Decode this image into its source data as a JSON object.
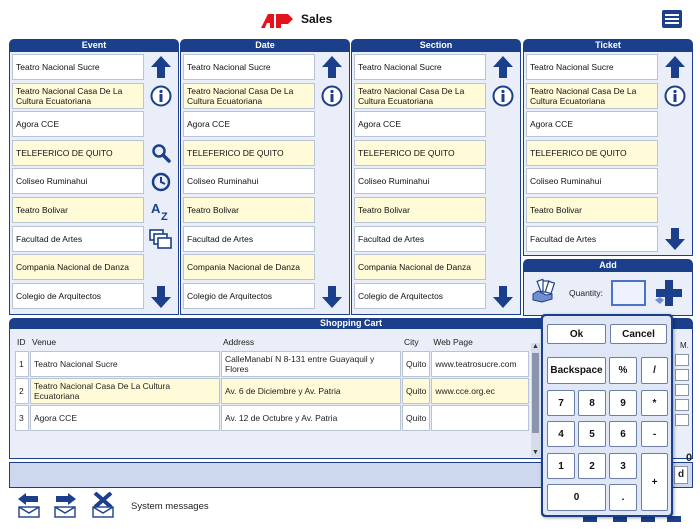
{
  "header": {
    "title": "Sales",
    "logo_text": "AP"
  },
  "columns": [
    {
      "id": "event",
      "title": "Event",
      "items": [
        "Teatro Nacional Sucre",
        "Teatro Nacional Casa De La Cultura Ecuatoriana",
        "Agora CCE",
        "TELEFERICO DE QUITO",
        "Coliseo Ruminahui",
        "Teatro Bolivar",
        "Facultad de Artes",
        "Compania Nacional de Danza",
        "Colegio de Arquitectos"
      ]
    },
    {
      "id": "date",
      "title": "Date",
      "items": [
        "Teatro Nacional Sucre",
        "Teatro Nacional Casa De La Cultura Ecuatoriana",
        "Agora CCE",
        "TELEFERICO DE QUITO",
        "Coliseo Ruminahui",
        "Teatro Bolivar",
        "Facultad de Artes",
        "Compania Nacional de Danza",
        "Colegio de Arquitectos"
      ]
    },
    {
      "id": "section",
      "title": "Section",
      "items": [
        "Teatro Nacional Sucre",
        "Teatro Nacional Casa De La Cultura Ecuatoriana",
        "Agora CCE",
        "TELEFERICO DE QUITO",
        "Coliseo Ruminahui",
        "Teatro Bolivar",
        "Facultad de Artes",
        "Compania Nacional de Danza",
        "Colegio de Arquitectos"
      ]
    },
    {
      "id": "ticket",
      "title": "Ticket",
      "items": [
        "Teatro Nacional Sucre",
        "Teatro Nacional Casa De La Cultura Ecuatoriana",
        "Agora CCE",
        "TELEFERICO DE QUITO",
        "Coliseo Ruminahui",
        "Teatro Bolivar",
        "Facultad de Artes"
      ]
    }
  ],
  "add": {
    "title": "Add",
    "quantity_label": "Quantity:",
    "quantity_value": ""
  },
  "cart": {
    "title": "Shopping Cart",
    "headers": [
      "ID",
      "Venue",
      "Address",
      "City",
      "Web Page"
    ],
    "rows": [
      [
        "1",
        "Teatro Nacional Sucre",
        "CalleManabí N 8-131 entre Guayaquil y Flores",
        "Quito",
        "www.teatrosucre.com"
      ],
      [
        "2",
        "Teatro Nacional Casa De La Cultura Ecuatoriana",
        "Av. 6 de Diciembre y Av. Patria",
        "Quito",
        "www.cce.org.ec"
      ],
      [
        "3",
        "Agora CCE",
        "Av. 12 de Octubre y Av. Patria",
        "Quito",
        ""
      ]
    ],
    "right_header_fragment": "M.",
    "total_fragment": "0"
  },
  "message_bar": {
    "right_button": "d"
  },
  "footer": {
    "system_messages": "System messages"
  },
  "keypad": {
    "ok": "Ok",
    "cancel": "Cancel",
    "backspace": "Backspace",
    "percent": "%",
    "divide": "/",
    "multiply": "*",
    "minus": "-",
    "plus": "+",
    "dot": ".",
    "d7": "7",
    "d8": "8",
    "d9": "9",
    "d4": "4",
    "d5": "5",
    "d6": "6",
    "d1": "1",
    "d2": "2",
    "d3": "3",
    "d0": "0"
  },
  "colors": {
    "accent": "#1b3f8b",
    "highlight_row": "#fffbd8",
    "panel_bg": "#e9eef8",
    "logo_red": "#e3121b"
  }
}
